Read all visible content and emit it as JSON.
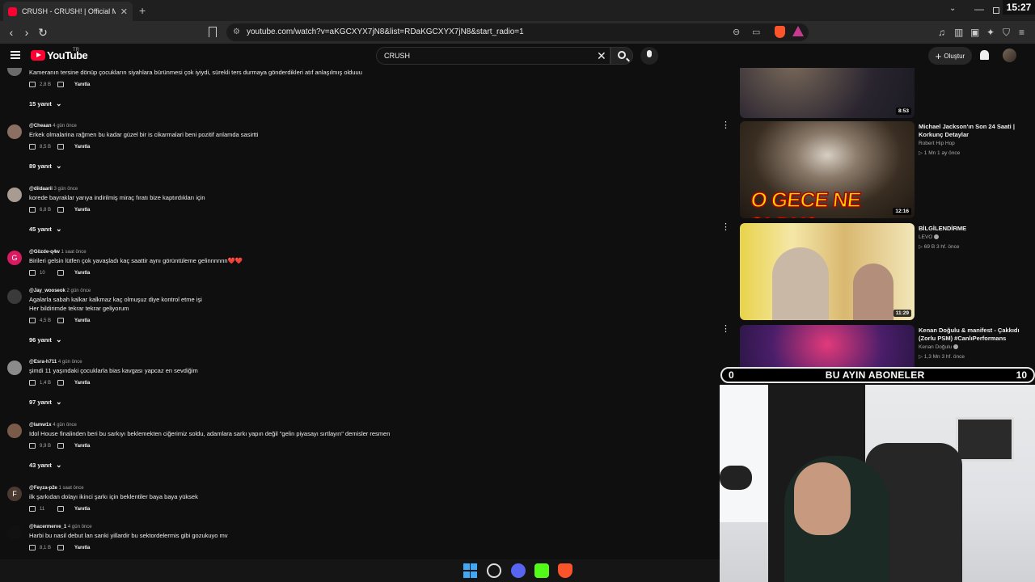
{
  "browser": {
    "tab_title": "CRUSH - CRUSH! | Official Music",
    "url": "youtube.com/watch?v=aKGCXYX7jN8&list=RDaKGCXYX7jN8&start_radio=1",
    "clock": "15:27"
  },
  "youtube": {
    "wordmark": "YouTube",
    "region": "TR",
    "search_value": "CRUSH",
    "create_label": "Oluştur"
  },
  "comments": [
    {
      "handle": "",
      "time": "",
      "text": [
        "Kameranın tersine dönüp çocukların siyahlara bürünmesi çok iyiydi, sürekli ters durmaya gönderdikleri atıf anlaşılmış olduuu"
      ],
      "likes": "2,8 B",
      "reply": "Yanıtla",
      "replies": "15 yanıt",
      "avatar_color": "#6b6b6b"
    },
    {
      "handle": "@Cheaan",
      "time": "4 gün önce",
      "text": [
        "Erkek olmalarina rağmen bu kadar güzel bir is cikarmalari beni pozitif anlamda sasirtti"
      ],
      "likes": "8,5 B",
      "reply": "Yanıtla",
      "replies": "89 yanıt",
      "avatar_color": "#8a6f62"
    },
    {
      "handle": "@diidaarii",
      "time": "3 gün önce",
      "text": [
        "korede bayraklar yarıya indirilmiş miraç fıratı bize kaptırdıkları için"
      ],
      "likes": "6,8 B",
      "reply": "Yanıtla",
      "replies": "45 yanıt",
      "avatar_color": "#a89c92"
    },
    {
      "handle": "@Gözde-q4w",
      "time": "1 saat önce",
      "text": [
        "Birileri gelsin lütfen çok yavaşladı kaç saattir aynı görüntüleme gelinnnnnn❤️❤️"
      ],
      "likes": "10",
      "reply": "Yanıtla",
      "replies": "",
      "avatar_color": "#d81b60",
      "avatar_letter": "G"
    },
    {
      "handle": "@Jay_wooseok",
      "time": "2 gün önce",
      "text": [
        "Agalarla sabah kalkar kalkmaz kaç olmuşuz diye kontrol etme işi",
        "Her bildirimde tekrar tekrar geliyorum"
      ],
      "likes": "4,5 B",
      "reply": "Yanıtla",
      "replies": "96 yanıt",
      "avatar_color": "#3a3a3a"
    },
    {
      "handle": "@Esra-h711",
      "time": "4 gün önce",
      "text": [
        "şimdi 11 yaşındaki çocuklarla bias kavgası yapcaz en sevdiğim"
      ],
      "likes": "1,4 B",
      "reply": "Yanıtla",
      "replies": "97 yanıt",
      "avatar_color": "#8b8b8b"
    },
    {
      "handle": "@lamw1x",
      "time": "4 gün önce",
      "text": [
        "Idol House finalinden beri bu sarkıyı beklemekten ciğerimiz soldu, adamlara sarkı yapın değil \"gelin piyasayı sırtlayın\" demisler resmen"
      ],
      "likes": "9,9 B",
      "reply": "Yanıtla",
      "replies": "43 yanıt",
      "avatar_color": "#7a5a48"
    },
    {
      "handle": "@Feyza-p2e",
      "time": "1 saat önce",
      "text": [
        "ilk şarkıdan dolayı ikinci şarkı için beklentiler baya baya yüksek"
      ],
      "likes": "11",
      "reply": "Yanıtla",
      "replies": "",
      "avatar_color": "#4a3a32",
      "avatar_letter": "F"
    },
    {
      "handle": "@hacermerve_1",
      "time": "4 gün önce",
      "text": [
        "Harbi bu nasil debut lan sanki yillardir bu sektordelermis gibi gozukuyo mv"
      ],
      "likes": "8,1 B",
      "reply": "Yanıtla",
      "replies": "",
      "avatar_color": "#111111"
    }
  ],
  "sidebar": [
    {
      "title": "",
      "channel": "",
      "stats": "",
      "duration": "8:53"
    },
    {
      "title": "Michael Jackson'ın Son 24 Saati | Korkunç Detaylar",
      "channel": "Robert Hip Hop",
      "stats": "▷ 1 Mn  1 ay önce",
      "duration": "12:16",
      "thumb_text": "O GECE NE OLDU?"
    },
    {
      "title": "BİLGİLENDİRME",
      "channel": "LEVO",
      "verified": true,
      "stats": "▷ 69 B  3 hf. önce",
      "duration": "11:29"
    },
    {
      "title": "Kenan Doğulu & manifest - Çakkıdı (Zorlu PSM) #CanlıPerformans",
      "channel": "Kenan Doğulu",
      "verified": true,
      "stats": "▷ 1,3 Mn  3 hf. önce",
      "duration": ""
    }
  ],
  "overlay": {
    "left_number": "0",
    "label": "BU AYIN ABONELER",
    "right_number": "10"
  },
  "colors": {
    "background": "#0f0f0f",
    "youtube_red": "#ff0033",
    "text": "#f1f1f1",
    "muted": "#aaaaaa"
  },
  "icons": [
    "youtube-favicon",
    "close-icon",
    "plus-icon",
    "back-icon",
    "forward-icon",
    "reload-icon",
    "bookmark-icon",
    "site-info-icon",
    "zoom-icon",
    "cast-icon",
    "brave-shield-icon",
    "brave-rewards-icon",
    "menu-icon",
    "search-icon",
    "mic-icon",
    "bell-icon",
    "like-icon",
    "dislike-icon",
    "chevron-down-icon",
    "more-vert-icon",
    "windows-start-icon"
  ]
}
